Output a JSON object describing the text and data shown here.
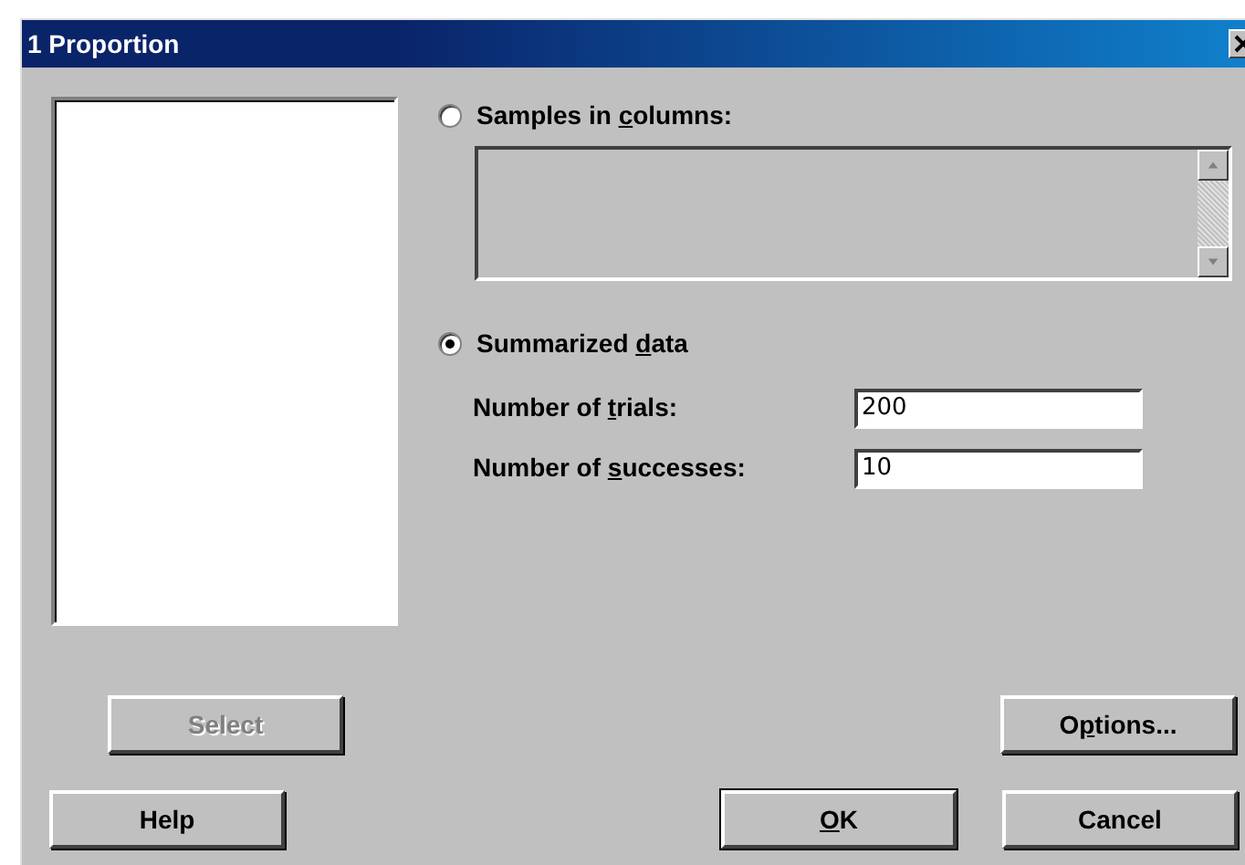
{
  "window": {
    "title": "1 Proportion"
  },
  "options": [
    {
      "kind": "columns",
      "text_before": "Samples in ",
      "mnemonic": "c",
      "text_after": "olumns:",
      "selected": false,
      "box_disabled": true
    },
    {
      "kind": "summarized",
      "text_before": "Summarized ",
      "mnemonic": "d",
      "text_after": "ata",
      "selected": true,
      "fields": [
        {
          "text_before": "Number of ",
          "mnemonic": "t",
          "text_after": "rials:",
          "value": "200"
        },
        {
          "text_before": "Number of ",
          "mnemonic": "s",
          "text_after": "uccesses:",
          "value": "10"
        }
      ]
    }
  ],
  "button_rows": [
    [
      {
        "text_before": "Select",
        "disabled": true,
        "default": false
      },
      {
        "text_before": "O",
        "mnemonic": "p",
        "text_after": "tions...",
        "disabled": false,
        "default": false
      }
    ],
    [
      {
        "text_before": "Help",
        "disabled": false,
        "default": false
      },
      {
        "mnemonic": "O",
        "text_after": "K",
        "disabled": false,
        "default": true
      },
      {
        "text_before": "Cancel",
        "disabled": false,
        "default": false
      }
    ]
  ]
}
